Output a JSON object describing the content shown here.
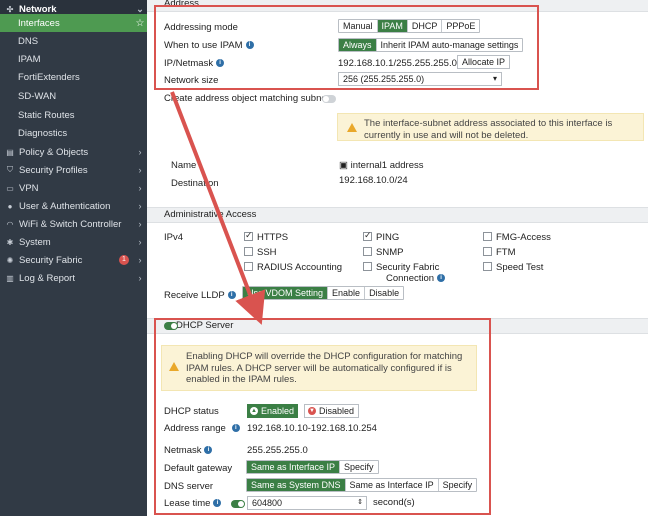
{
  "sidebar": {
    "network": "Network",
    "items": [
      {
        "label": "Interfaces",
        "active": true
      },
      {
        "label": "DNS"
      },
      {
        "label": "IPAM"
      },
      {
        "label": "FortiExtenders"
      },
      {
        "label": "SD-WAN"
      },
      {
        "label": "Static Routes"
      },
      {
        "label": "Diagnostics"
      }
    ],
    "top": [
      {
        "label": "Policy & Objects",
        "icon": "policy-icon"
      },
      {
        "label": "Security Profiles",
        "icon": "shield-icon"
      },
      {
        "label": "VPN",
        "icon": "monitor-icon"
      },
      {
        "label": "User & Authentication",
        "icon": "user-icon"
      },
      {
        "label": "WiFi & Switch Controller",
        "icon": "wifi-icon"
      },
      {
        "label": "System",
        "icon": "gear-icon"
      },
      {
        "label": "Security Fabric",
        "icon": "fabric-icon",
        "badge": "1"
      },
      {
        "label": "Log & Report",
        "icon": "chart-icon"
      }
    ]
  },
  "address": {
    "section": "Address",
    "addressing_mode_label": "Addressing mode",
    "modes": [
      "Manual",
      "IPAM",
      "DHCP",
      "PPPoE"
    ],
    "selected_mode": "IPAM",
    "when_label": "When to use IPAM",
    "when_options": [
      "Always",
      "Inherit IPAM auto-manage settings"
    ],
    "ip_label": "IP/Netmask",
    "ip_value": "192.168.10.1/255.255.255.0",
    "allocate_button": "Allocate IP",
    "network_size_label": "Network size",
    "network_size_value": "256 (255.255.255.0)",
    "create_object_label": "Create address object matching subnet",
    "warning": "The interface-subnet address associated to this interface is currently in use and will not be deleted.",
    "name_label": "Name",
    "name_value": "internal1 address",
    "destination_label": "Destination",
    "destination_value": "192.168.10.0/24"
  },
  "admin": {
    "section": "Administrative Access",
    "ipv4_label": "IPv4",
    "checks": [
      {
        "label": "HTTPS",
        "checked": true
      },
      {
        "label": "PING",
        "checked": true
      },
      {
        "label": "FMG-Access",
        "checked": false
      },
      {
        "label": "SSH",
        "checked": false
      },
      {
        "label": "SNMP",
        "checked": false
      },
      {
        "label": "FTM",
        "checked": false
      },
      {
        "label": "RADIUS Accounting",
        "checked": false
      },
      {
        "label": "Security Fabric",
        "checked": false
      },
      {
        "label": "Speed Test",
        "checked": false
      }
    ],
    "connection_label": "Connection",
    "lldp_label": "Receive LLDP",
    "lldp_options": [
      "Use VDOM Setting",
      "Enable",
      "Disable"
    ]
  },
  "dhcp": {
    "section": "DHCP Server",
    "warning": "Enabling DHCP will override the DHCP configuration for matching IPAM rules. A DHCP server will be automatically configured if is enabled in the IPAM rules.",
    "status_label": "DHCP status",
    "enabled": "Enabled",
    "disabled": "Disabled",
    "range_label": "Address range",
    "range_value": "192.168.10.10-192.168.10.254",
    "netmask_label": "Netmask",
    "netmask_value": "255.255.255.0",
    "gateway_label": "Default gateway",
    "gateway_options": [
      "Same as Interface IP",
      "Specify"
    ],
    "dns_label": "DNS server",
    "dns_options": [
      "Same as System DNS",
      "Same as Interface IP",
      "Specify"
    ],
    "lease_label": "Lease time",
    "lease_value": "604800",
    "lease_unit": "second(s)"
  }
}
